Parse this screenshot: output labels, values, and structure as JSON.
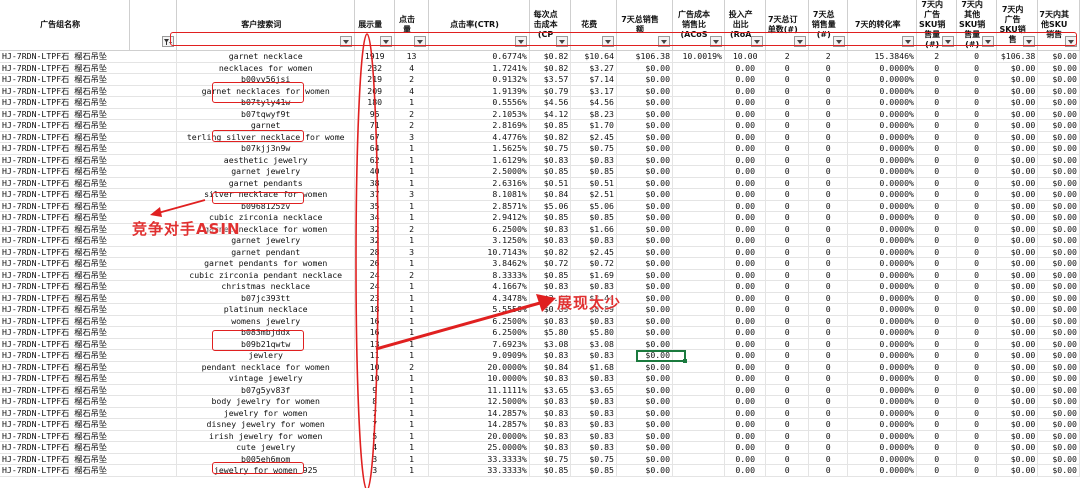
{
  "headers": [
    {
      "key": "group",
      "label": "广告组名称",
      "filter": false
    },
    {
      "key": "fbtn",
      "label": "",
      "filter": true,
      "filter_active": true
    },
    {
      "key": "term",
      "label": "客户搜索词",
      "filter": true
    },
    {
      "key": "impr",
      "label": "展示量",
      "filter": true
    },
    {
      "key": "clicks",
      "label": "点击量",
      "filter": true
    },
    {
      "key": "ctr",
      "label": "点击率(CTR)",
      "filter": true
    },
    {
      "key": "cpc",
      "label": "每次点击成本(CP",
      "filter": true
    },
    {
      "key": "spend",
      "label": "花费",
      "filter": true
    },
    {
      "key": "sales7",
      "label": "7天总销售额",
      "filter": true
    },
    {
      "key": "acos",
      "label": "广告成本销售比(ACoS",
      "filter": true
    },
    {
      "key": "roas",
      "label": "投入产出比(RoA",
      "filter": true
    },
    {
      "key": "orders7",
      "label": "7天总订单数(#)",
      "filter": true
    },
    {
      "key": "units7",
      "label": "7天总销售量(#)",
      "filter": true
    },
    {
      "key": "conv7",
      "label": "7天的转化率",
      "filter": true
    },
    {
      "key": "adsku",
      "label": "7天内广告SKU销售量(#)",
      "filter": true
    },
    {
      "key": "othersku",
      "label": "7天内其他SKU销售量(#)",
      "filter": true
    },
    {
      "key": "adskusales",
      "label": "7天内广告SKU销售",
      "filter": true
    },
    {
      "key": "otherskusales",
      "label": "7天内其他SKU销售",
      "filter": true
    }
  ],
  "rows": [
    [
      "HJ-7RDN-LTPF石 榴石吊坠",
      "garnet necklace",
      "1919",
      "13",
      "0.6774%",
      "$0.82",
      "$10.64",
      "$106.38",
      "10.0019%",
      "10.00",
      "2",
      "2",
      "15.3846%",
      "2",
      "0",
      "$106.38",
      "$0.00"
    ],
    [
      "HJ-7RDN-LTPF石 榴石吊坠",
      "necklaces for women",
      "232",
      "4",
      "1.7241%",
      "$0.82",
      "$3.27",
      "$0.00",
      "",
      "0.00",
      "0",
      "0",
      "0.0000%",
      "0",
      "0",
      "$0.00",
      "$0.00"
    ],
    [
      "HJ-7RDN-LTPF石 榴石吊坠",
      "b00vv56jsi",
      "219",
      "2",
      "0.9132%",
      "$3.57",
      "$7.14",
      "$0.00",
      "",
      "0.00",
      "0",
      "0",
      "0.0000%",
      "0",
      "0",
      "$0.00",
      "$0.00"
    ],
    [
      "HJ-7RDN-LTPF石 榴石吊坠",
      "garnet necklaces for women",
      "209",
      "4",
      "1.9139%",
      "$0.79",
      "$3.17",
      "$0.00",
      "",
      "0.00",
      "0",
      "0",
      "0.0000%",
      "0",
      "0",
      "$0.00",
      "$0.00"
    ],
    [
      "HJ-7RDN-LTPF石 榴石吊坠",
      "b07tyly41w",
      "180",
      "1",
      "0.5556%",
      "$4.56",
      "$4.56",
      "$0.00",
      "",
      "0.00",
      "0",
      "0",
      "0.0000%",
      "0",
      "0",
      "$0.00",
      "$0.00"
    ],
    [
      "HJ-7RDN-LTPF石 榴石吊坠",
      "b07tqwyf9t",
      "95",
      "2",
      "2.1053%",
      "$4.12",
      "$8.23",
      "$0.00",
      "",
      "0.00",
      "0",
      "0",
      "0.0000%",
      "0",
      "0",
      "$0.00",
      "$0.00"
    ],
    [
      "HJ-7RDN-LTPF石 榴石吊坠",
      "garnet",
      "71",
      "2",
      "2.8169%",
      "$0.85",
      "$1.70",
      "$0.00",
      "",
      "0.00",
      "0",
      "0",
      "0.0000%",
      "0",
      "0",
      "$0.00",
      "$0.00"
    ],
    [
      "HJ-7RDN-LTPF石 榴石吊坠",
      "terling silver necklace for wome",
      "67",
      "3",
      "4.4776%",
      "$0.82",
      "$2.45",
      "$0.00",
      "",
      "0.00",
      "0",
      "0",
      "0.0000%",
      "0",
      "0",
      "$0.00",
      "$0.00"
    ],
    [
      "HJ-7RDN-LTPF石 榴石吊坠",
      "b07kjj3n9w",
      "64",
      "1",
      "1.5625%",
      "$0.75",
      "$0.75",
      "$0.00",
      "",
      "0.00",
      "0",
      "0",
      "0.0000%",
      "0",
      "0",
      "$0.00",
      "$0.00"
    ],
    [
      "HJ-7RDN-LTPF石 榴石吊坠",
      "aesthetic jewelry",
      "62",
      "1",
      "1.6129%",
      "$0.83",
      "$0.83",
      "$0.00",
      "",
      "0.00",
      "0",
      "0",
      "0.0000%",
      "0",
      "0",
      "$0.00",
      "$0.00"
    ],
    [
      "HJ-7RDN-LTPF石 榴石吊坠",
      "garnet jewelry",
      "40",
      "1",
      "2.5000%",
      "$0.85",
      "$0.85",
      "$0.00",
      "",
      "0.00",
      "0",
      "0",
      "0.0000%",
      "0",
      "0",
      "$0.00",
      "$0.00"
    ],
    [
      "HJ-7RDN-LTPF石 榴石吊坠",
      "garnet pendants",
      "38",
      "1",
      "2.6316%",
      "$0.51",
      "$0.51",
      "$0.00",
      "",
      "0.00",
      "0",
      "0",
      "0.0000%",
      "0",
      "0",
      "$0.00",
      "$0.00"
    ],
    [
      "HJ-7RDN-LTPF石 榴石吊坠",
      "silver necklace for women",
      "37",
      "3",
      "8.1081%",
      "$0.84",
      "$2.51",
      "$0.00",
      "",
      "0.00",
      "0",
      "0",
      "0.0000%",
      "0",
      "0",
      "$0.00",
      "$0.00"
    ],
    [
      "HJ-7RDN-LTPF石 榴石吊坠",
      "b0968125zv",
      "35",
      "1",
      "2.8571%",
      "$5.06",
      "$5.06",
      "$0.00",
      "",
      "0.00",
      "0",
      "0",
      "0.0000%",
      "0",
      "0",
      "$0.00",
      "$0.00"
    ],
    [
      "HJ-7RDN-LTPF石 榴石吊坠",
      "cubic zirconia necklace",
      "34",
      "1",
      "2.9412%",
      "$0.85",
      "$0.85",
      "$0.00",
      "",
      "0.00",
      "0",
      "0",
      "0.0000%",
      "0",
      "0",
      "$0.00",
      "$0.00"
    ],
    [
      "HJ-7RDN-LTPF石 榴石吊坠",
      "garnet necklace for women",
      "32",
      "2",
      "6.2500%",
      "$0.83",
      "$1.66",
      "$0.00",
      "",
      "0.00",
      "0",
      "0",
      "0.0000%",
      "0",
      "0",
      "$0.00",
      "$0.00"
    ],
    [
      "HJ-7RDN-LTPF石 榴石吊坠",
      "garnet jewelry",
      "32",
      "1",
      "3.1250%",
      "$0.83",
      "$0.83",
      "$0.00",
      "",
      "0.00",
      "0",
      "0",
      "0.0000%",
      "0",
      "0",
      "$0.00",
      "$0.00"
    ],
    [
      "HJ-7RDN-LTPF石 榴石吊坠",
      "garnet pendant",
      "28",
      "3",
      "10.7143%",
      "$0.82",
      "$2.45",
      "$0.00",
      "",
      "0.00",
      "0",
      "0",
      "0.0000%",
      "0",
      "0",
      "$0.00",
      "$0.00"
    ],
    [
      "HJ-7RDN-LTPF石 榴石吊坠",
      "garnet pendants for women",
      "26",
      "1",
      "3.8462%",
      "$0.72",
      "$0.72",
      "$0.00",
      "",
      "0.00",
      "0",
      "0",
      "0.0000%",
      "0",
      "0",
      "$0.00",
      "$0.00"
    ],
    [
      "HJ-7RDN-LTPF石 榴石吊坠",
      "cubic zirconia pendant necklace",
      "24",
      "2",
      "8.3333%",
      "$0.85",
      "$1.69",
      "$0.00",
      "",
      "0.00",
      "0",
      "0",
      "0.0000%",
      "0",
      "0",
      "$0.00",
      "$0.00"
    ],
    [
      "HJ-7RDN-LTPF石 榴石吊坠",
      "christmas necklace",
      "24",
      "1",
      "4.1667%",
      "$0.83",
      "$0.83",
      "$0.00",
      "",
      "0.00",
      "0",
      "0",
      "0.0000%",
      "0",
      "0",
      "$0.00",
      "$0.00"
    ],
    [
      "HJ-7RDN-LTPF石 榴石吊坠",
      "b07jc393tt",
      "23",
      "1",
      "4.3478%",
      "$3.44",
      "$3.44",
      "$0.00",
      "",
      "0.00",
      "0",
      "0",
      "0.0000%",
      "0",
      "0",
      "$0.00",
      "$0.00"
    ],
    [
      "HJ-7RDN-LTPF石 榴石吊坠",
      "platinum necklace",
      "18",
      "1",
      "5.5556%",
      "$0.89",
      "$0.89",
      "$0.00",
      "",
      "0.00",
      "0",
      "0",
      "0.0000%",
      "0",
      "0",
      "$0.00",
      "$0.00"
    ],
    [
      "HJ-7RDN-LTPF石 榴石吊坠",
      "womens jewelry",
      "16",
      "1",
      "6.2500%",
      "$0.83",
      "$0.83",
      "$0.00",
      "",
      "0.00",
      "0",
      "0",
      "0.0000%",
      "0",
      "0",
      "$0.00",
      "$0.00"
    ],
    [
      "HJ-7RDN-LTPF石 榴石吊坠",
      "b083mbjddx",
      "16",
      "1",
      "6.2500%",
      "$5.80",
      "$5.80",
      "$0.00",
      "",
      "0.00",
      "0",
      "0",
      "0.0000%",
      "0",
      "0",
      "$0.00",
      "$0.00"
    ],
    [
      "HJ-7RDN-LTPF石 榴石吊坠",
      "b09b21qwtw",
      "13",
      "1",
      "7.6923%",
      "$3.08",
      "$3.08",
      "$0.00",
      "",
      "0.00",
      "0",
      "0",
      "0.0000%",
      "0",
      "0",
      "$0.00",
      "$0.00"
    ],
    [
      "HJ-7RDN-LTPF石 榴石吊坠",
      "jewlery",
      "11",
      "1",
      "9.0909%",
      "$0.83",
      "$0.83",
      "$0.00",
      "",
      "0.00",
      "0",
      "0",
      "0.0000%",
      "0",
      "0",
      "$0.00",
      "$0.00"
    ],
    [
      "HJ-7RDN-LTPF石 榴石吊坠",
      "pendant necklace for women",
      "10",
      "2",
      "20.0000%",
      "$0.84",
      "$1.68",
      "$0.00",
      "",
      "0.00",
      "0",
      "0",
      "0.0000%",
      "0",
      "0",
      "$0.00",
      "$0.00"
    ],
    [
      "HJ-7RDN-LTPF石 榴石吊坠",
      "vintage jewelry",
      "10",
      "1",
      "10.0000%",
      "$0.83",
      "$0.83",
      "$0.00",
      "",
      "0.00",
      "0",
      "0",
      "0.0000%",
      "0",
      "0",
      "$0.00",
      "$0.00"
    ],
    [
      "HJ-7RDN-LTPF石 榴石吊坠",
      "b07g5yv83f",
      "9",
      "1",
      "11.1111%",
      "$3.65",
      "$3.65",
      "$0.00",
      "",
      "0.00",
      "0",
      "0",
      "0.0000%",
      "0",
      "0",
      "$0.00",
      "$0.00"
    ],
    [
      "HJ-7RDN-LTPF石 榴石吊坠",
      "body jewelry for women",
      "8",
      "1",
      "12.5000%",
      "$0.83",
      "$0.83",
      "$0.00",
      "",
      "0.00",
      "0",
      "0",
      "0.0000%",
      "0",
      "0",
      "$0.00",
      "$0.00"
    ],
    [
      "HJ-7RDN-LTPF石 榴石吊坠",
      "jewelry for women",
      "7",
      "1",
      "14.2857%",
      "$0.83",
      "$0.83",
      "$0.00",
      "",
      "0.00",
      "0",
      "0",
      "0.0000%",
      "0",
      "0",
      "$0.00",
      "$0.00"
    ],
    [
      "HJ-7RDN-LTPF石 榴石吊坠",
      "disney jewelry for women",
      "7",
      "1",
      "14.2857%",
      "$0.83",
      "$0.83",
      "$0.00",
      "",
      "0.00",
      "0",
      "0",
      "0.0000%",
      "0",
      "0",
      "$0.00",
      "$0.00"
    ],
    [
      "HJ-7RDN-LTPF石 榴石吊坠",
      "irish jewelry for women",
      "5",
      "1",
      "20.0000%",
      "$0.83",
      "$0.83",
      "$0.00",
      "",
      "0.00",
      "0",
      "0",
      "0.0000%",
      "0",
      "0",
      "$0.00",
      "$0.00"
    ],
    [
      "HJ-7RDN-LTPF石 榴石吊坠",
      "cute jewelry",
      "4",
      "1",
      "25.0000%",
      "$0.83",
      "$0.83",
      "$0.00",
      "",
      "0.00",
      "0",
      "0",
      "0.0000%",
      "0",
      "0",
      "$0.00",
      "$0.00"
    ],
    [
      "HJ-7RDN-LTPF石 榴石吊坠",
      "b005eh6mom",
      "3",
      "1",
      "33.3333%",
      "$0.75",
      "$0.75",
      "$0.00",
      "",
      "0.00",
      "0",
      "0",
      "0.0000%",
      "0",
      "0",
      "$0.00",
      "$0.00"
    ],
    [
      "HJ-7RDN-LTPF石 榴石吊坠",
      "jewelry for women 925",
      "3",
      "1",
      "33.3333%",
      "$0.85",
      "$0.85",
      "$0.00",
      "",
      "0.00",
      "0",
      "0",
      "0.0000%",
      "0",
      "0",
      "$0.00",
      "$0.00"
    ]
  ],
  "annotations": {
    "competitor_label": "竞争对手ASIN",
    "low_impressions_label": "展现太少",
    "color": "#e02020"
  },
  "colors": {
    "header_bg": "#ffffff",
    "grid": "#e4e4e4",
    "selection": "#1b7a3e",
    "annotation": "#e02020"
  }
}
